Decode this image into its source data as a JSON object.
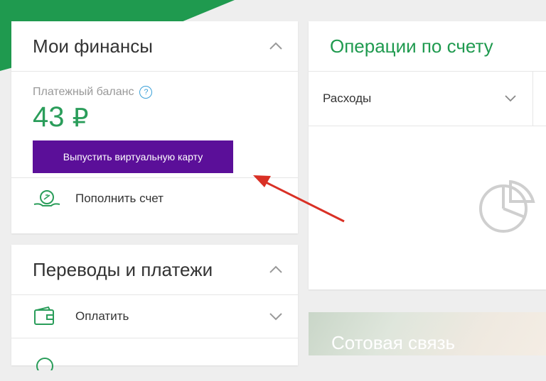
{
  "finances": {
    "title": "Мои финансы",
    "balance_label": "Платежный баланс",
    "balance_value": "43",
    "currency": "₽",
    "virtual_card_button": "Выпустить виртуальную карту",
    "topup_label": "Пополнить счет"
  },
  "transfers": {
    "title": "Переводы и платежи",
    "pay_label": "Оплатить"
  },
  "operations": {
    "title": "Операции по счету",
    "filter_value": "Расходы"
  },
  "promo": {
    "title": "Сотовая связь"
  },
  "colors": {
    "brand_green": "#1f9a4f",
    "button_purple": "#5b0f99",
    "arrow_red": "#d93025"
  }
}
